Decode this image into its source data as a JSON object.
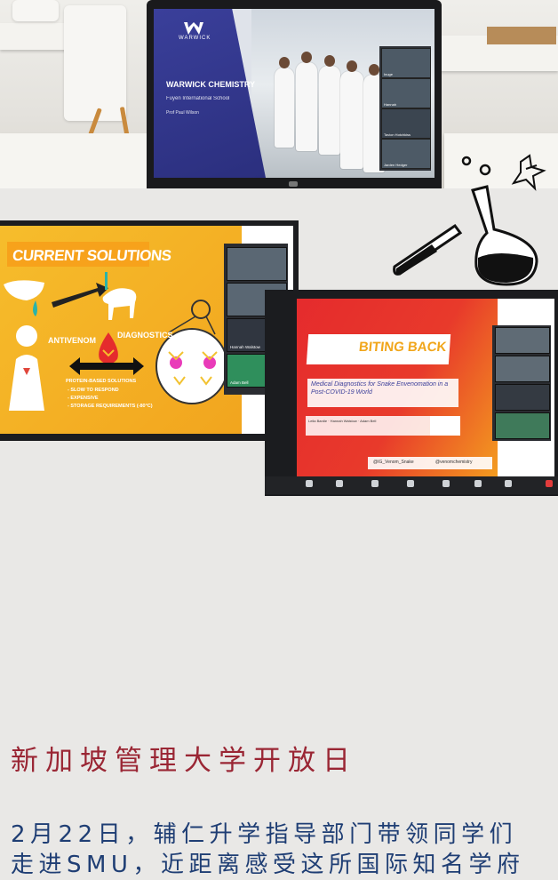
{
  "photos": [
    {
      "name": "laptop-video-call",
      "slide": {
        "brand": "WARWICK",
        "title": "WARWICK CHEMISTRY",
        "subtitle": "Fuyen International School",
        "presenter_label": "Prof Paul Wilson",
        "participants": [
          "Inuge",
          "Hannah",
          "Natalie",
          "",
          "Tavion Hotchkiss",
          "",
          "Jarden Hedger"
        ]
      }
    },
    {
      "name": "monitor-current-solutions",
      "slide": {
        "title": "CURRENT SOLUTIONS",
        "labels": [
          "ANTIVENOM",
          "DIAGNOSTICS"
        ],
        "bullets": [
          "PROTEIN-BASED SOLUTIONS",
          "- SLOW TO RESPOND",
          "- EXPENSIVE",
          "- STORAGE REQUIREMENTS (-80°C)"
        ],
        "participants": [
          "",
          "",
          "Hannah Walstow",
          "",
          "Adam Bell"
        ]
      }
    },
    {
      "name": "monitor-biting-back",
      "slide": {
        "title": "BITING BACK",
        "subtitle": "Medical Diagnostics for Snake Envenomation in a Post-COVID-19 World",
        "authors": "Leila Bardie · Hannah Walstow · Adam Bell",
        "social": [
          "@IG_Venom_Snake",
          "@venomchemistry"
        ]
      }
    }
  ],
  "section": {
    "title": "新加坡管理大学开放日",
    "body_lines": [
      "2月22日，辅仁升学指导部门带领同学们",
      "走进SMU，近距离感受这所国际知名学府"
    ]
  },
  "colors": {
    "title": "#9a2634",
    "body": "#1f3e74",
    "background": "#e9e8e6",
    "warwick_blue": "#3a3f9a",
    "slide_yellow": "#f6bd2c",
    "slide_red": "#e52b2d"
  }
}
